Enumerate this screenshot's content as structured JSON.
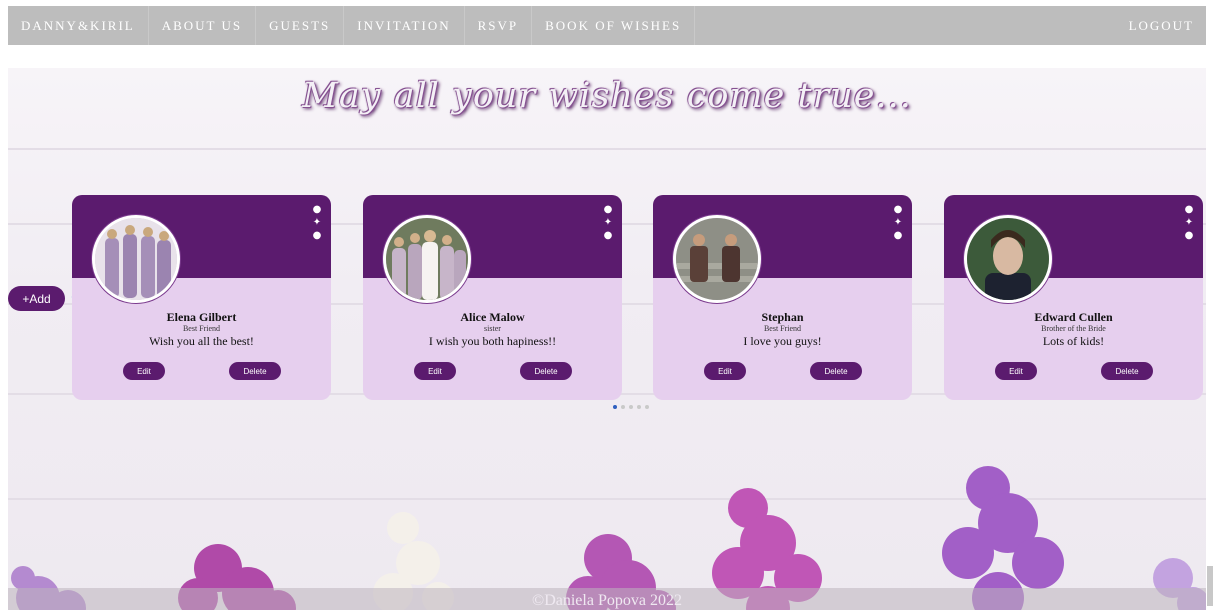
{
  "nav": {
    "items": [
      "DANNY&KIRIL",
      "ABOUT US",
      "GUESTS",
      "INVITATION",
      "RSVP",
      "BOOK OF WISHES"
    ],
    "logout": "LOGOUT"
  },
  "headline": "May all your wishes come true...",
  "add_label": "+Add",
  "cards": [
    {
      "name": "Elena Gilbert",
      "relation": "Best Friend",
      "message": "Wish you all the best!",
      "edit": "Edit",
      "delete": "Delete"
    },
    {
      "name": "Alice Malow",
      "relation": "sister",
      "message": "I wish you both hapiness!!",
      "edit": "Edit",
      "delete": "Delete"
    },
    {
      "name": "Stephan",
      "relation": "Best Friend",
      "message": "I love you guys!",
      "edit": "Edit",
      "delete": "Delete"
    },
    {
      "name": "Edward Cullen",
      "relation": "Brother of the Bride",
      "message": "Lots of kids!",
      "edit": "Edit",
      "delete": "Delete"
    }
  ],
  "social_icons": [
    "facebook-icon",
    "twitter-icon",
    "github-icon"
  ],
  "carousel": {
    "page_count": 5,
    "active_index": 0
  },
  "footer": "©Daniela Popova 2022",
  "colors": {
    "nav_bg": "#bdbdbd",
    "card_header": "#5b1b6e",
    "card_body": "#e6cfee",
    "accent_arrow": "#3a8fd6"
  }
}
